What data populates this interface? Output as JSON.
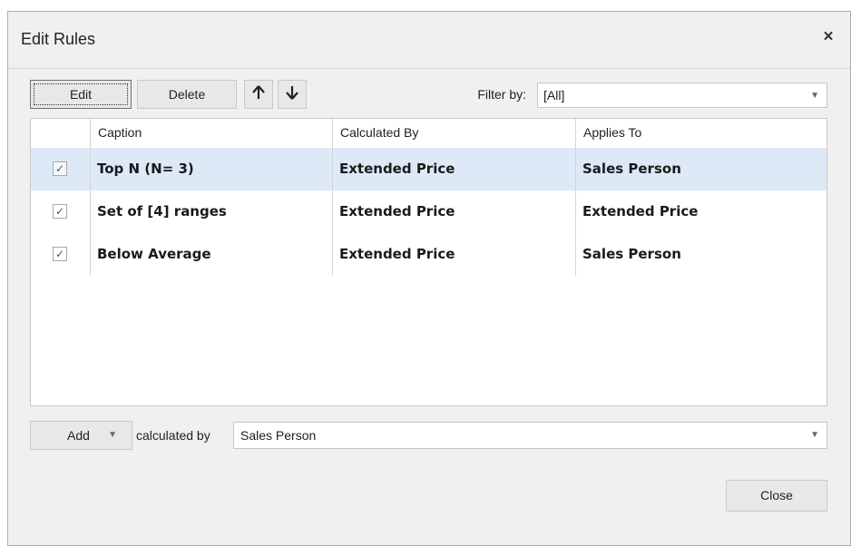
{
  "dialog": {
    "title": "Edit Rules",
    "close_glyph": "×"
  },
  "toolbar": {
    "edit_label": "Edit",
    "delete_label": "Delete",
    "up_glyph": "🡑",
    "down_glyph": "🡓",
    "filter_label": "Filter by:",
    "filter_value": "[All]"
  },
  "grid": {
    "columns": [
      "Caption",
      "Calculated By",
      "Applies To"
    ],
    "rows": [
      {
        "checked": true,
        "caption": "Top N (N= 3)",
        "calculated_by": "Extended Price",
        "applies_to": "Sales Person",
        "selected": true
      },
      {
        "checked": true,
        "caption": "Set of [4] ranges",
        "calculated_by": "Extended Price",
        "applies_to": "Extended Price",
        "selected": false
      },
      {
        "checked": true,
        "caption": "Below Average",
        "calculated_by": "Extended Price",
        "applies_to": "Sales Person",
        "selected": false
      }
    ]
  },
  "bottom": {
    "add_label": "Add",
    "calculated_by_label": "calculated by",
    "calculated_by_value": "Sales Person",
    "close_label": "Close"
  },
  "colors": {
    "selected_row": "#dde9f6",
    "dialog_bg": "#f0f0f0"
  },
  "icons": {
    "check": "checkmark-icon",
    "caret": "chevron-down-icon"
  }
}
